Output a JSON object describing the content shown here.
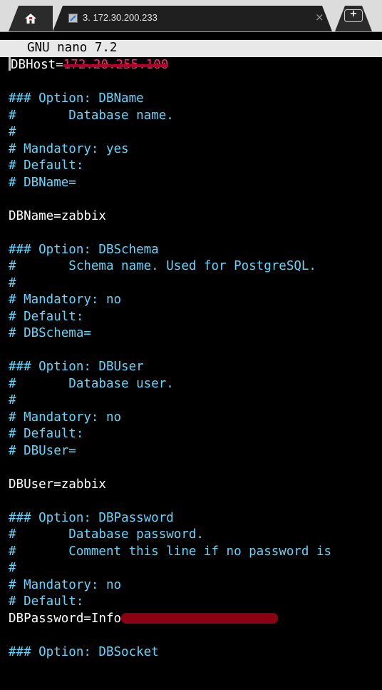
{
  "tab": {
    "title": "3. 172.30.200.233",
    "close_glyph": "×",
    "new_tab_glyph": "+",
    "home_icon": "home-icon",
    "session_icon": "terminal-session-icon"
  },
  "nano": {
    "header": "GNU nano 7.2"
  },
  "editor": {
    "lines": [
      {
        "kind": "value",
        "key": "DBHost=",
        "value": "172.20.255.100",
        "redaction": "strike"
      },
      {
        "kind": "blank",
        "text": ""
      },
      {
        "kind": "comment",
        "text": "### Option: DBName"
      },
      {
        "kind": "comment",
        "text": "#       Database name."
      },
      {
        "kind": "comment",
        "text": "#"
      },
      {
        "kind": "comment",
        "text": "# Mandatory: yes"
      },
      {
        "kind": "comment",
        "text": "# Default:"
      },
      {
        "kind": "comment",
        "text": "# DBName="
      },
      {
        "kind": "blank",
        "text": ""
      },
      {
        "kind": "plain",
        "text": "DBName=zabbix"
      },
      {
        "kind": "blank",
        "text": ""
      },
      {
        "kind": "comment",
        "text": "### Option: DBSchema"
      },
      {
        "kind": "comment",
        "text": "#       Schema name. Used for PostgreSQL."
      },
      {
        "kind": "comment",
        "text": "#"
      },
      {
        "kind": "comment",
        "text": "# Mandatory: no"
      },
      {
        "kind": "comment",
        "text": "# Default:"
      },
      {
        "kind": "comment",
        "text": "# DBSchema="
      },
      {
        "kind": "blank",
        "text": ""
      },
      {
        "kind": "comment",
        "text": "### Option: DBUser"
      },
      {
        "kind": "comment",
        "text": "#       Database user."
      },
      {
        "kind": "comment",
        "text": "#"
      },
      {
        "kind": "comment",
        "text": "# Mandatory: no"
      },
      {
        "kind": "comment",
        "text": "# Default:"
      },
      {
        "kind": "comment",
        "text": "# DBUser="
      },
      {
        "kind": "blank",
        "text": ""
      },
      {
        "kind": "plain",
        "text": "DBUser=zabbix"
      },
      {
        "kind": "blank",
        "text": ""
      },
      {
        "kind": "comment",
        "text": "### Option: DBPassword"
      },
      {
        "kind": "comment",
        "text": "#       Database password."
      },
      {
        "kind": "comment",
        "text": "#       Comment this line if no password is"
      },
      {
        "kind": "comment",
        "text": "#"
      },
      {
        "kind": "comment",
        "text": "# Mandatory: no"
      },
      {
        "kind": "comment",
        "text": "# Default:"
      },
      {
        "kind": "value",
        "key": "DBPassword=",
        "value": "Info",
        "redaction": "bar"
      },
      {
        "kind": "blank",
        "text": ""
      },
      {
        "kind": "comment",
        "text": "### Option: DBSocket"
      }
    ]
  },
  "colors": {
    "terminal_bg": "#000000",
    "comment": "#5fd7ff",
    "text": "#ffffff",
    "header_bg": "#e8e8e8",
    "redaction_strike": "#ff2a6d",
    "redaction_bar": "#8c0013"
  }
}
